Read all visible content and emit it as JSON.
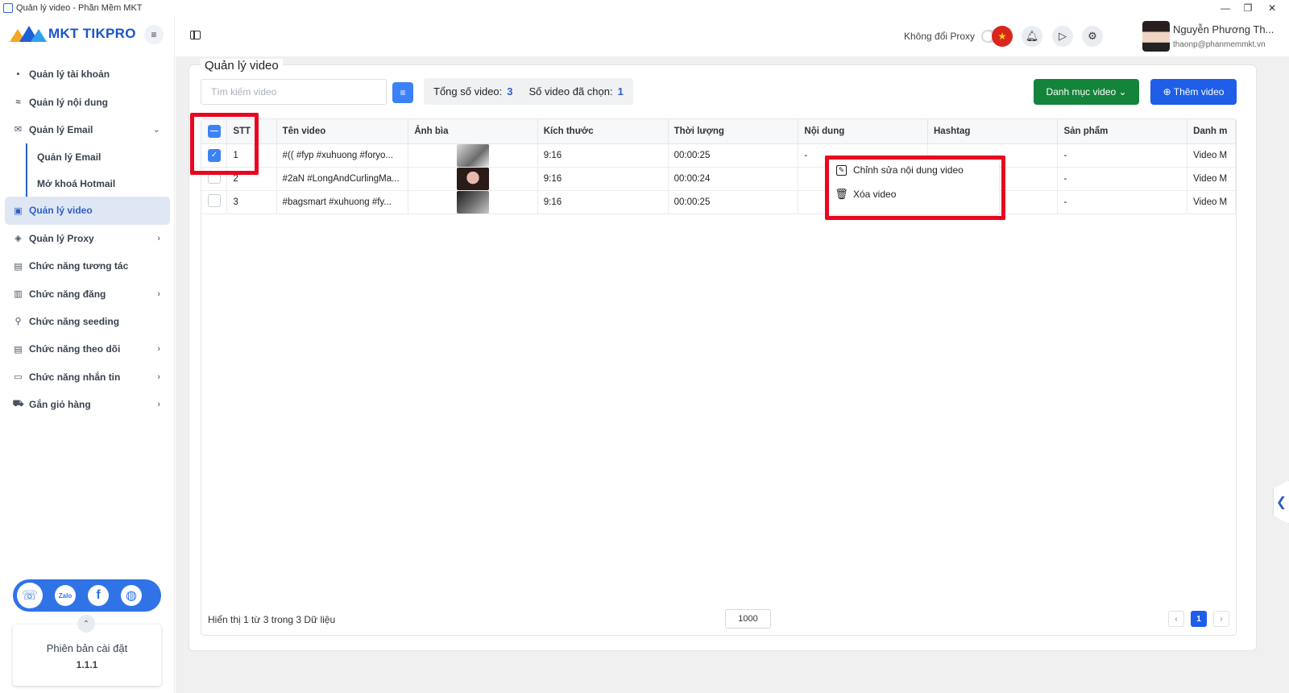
{
  "window": {
    "title": "Quản lý video - Phần Mềm MKT",
    "minimize": "—",
    "restore": "❐",
    "close": "✕"
  },
  "sidebar": {
    "logo_text": "MKT TIKPRO",
    "menu_icon": "≡",
    "items": [
      {
        "label": "Quản lý tài khoản",
        "icon": "grid-icon",
        "glyph": "▪",
        "chevron": ""
      },
      {
        "label": "Quản lý nội dung",
        "icon": "content-icon",
        "glyph": "≈",
        "chevron": ""
      },
      {
        "label": "Quản lý Email",
        "icon": "email-icon",
        "glyph": "✉",
        "chevron": "⌄"
      },
      {
        "label": "Quản lý video",
        "icon": "video-icon",
        "glyph": "▣",
        "chevron": ""
      },
      {
        "label": "Quản lý Proxy",
        "icon": "layers-icon",
        "glyph": "◈",
        "chevron": "›"
      },
      {
        "label": "Chức năng tương tác",
        "icon": "interact-icon",
        "glyph": "▤",
        "chevron": ""
      },
      {
        "label": "Chức năng đăng",
        "icon": "post-icon",
        "glyph": "▥",
        "chevron": "›"
      },
      {
        "label": "Chức năng seeding",
        "icon": "seeding-icon",
        "glyph": "⚲",
        "chevron": ""
      },
      {
        "label": "Chức năng theo dõi",
        "icon": "follow-icon",
        "glyph": "▤",
        "chevron": "›"
      },
      {
        "label": "Chức năng nhắn tin",
        "icon": "message-icon",
        "glyph": "▭",
        "chevron": "›"
      },
      {
        "label": "Gắn giỏ hàng",
        "icon": "cart-icon",
        "glyph": "⛟",
        "chevron": "›"
      }
    ],
    "sub_items": [
      {
        "label": "Quản lý Email"
      },
      {
        "label": "Mở khoá Hotmail"
      }
    ],
    "social": {
      "support_glyph": "☏",
      "zalo_glyph": "Zalo",
      "facebook_glyph": "f",
      "web_glyph": "◍"
    },
    "collapse_glyph": "⌃",
    "version_label": "Phiên bản cài đặt",
    "version_number": "1.1.1"
  },
  "topbar": {
    "proxy_label": "Không đổi Proxy",
    "flag_glyph": "★",
    "bell_glyph": "🔔︎",
    "play_glyph": "▷",
    "gear_glyph": "⚙",
    "user_name": "Nguyễn Phương Th...",
    "user_email": "thaonp@phanmemmkt.vn"
  },
  "page": {
    "title": "Quản lý video",
    "search_placeholder": "Tìm kiếm video",
    "filter_glyph": "≡",
    "total_label": "Tổng số video:",
    "total_value": "3",
    "selected_label": "Số video đã chọn:",
    "selected_value": "1",
    "category_button": "Danh mục video  ⌄",
    "add_button": "⊕  Thêm video"
  },
  "table": {
    "columns": [
      "STT",
      "Tên video",
      "Ảnh bìa",
      "Kích thước",
      "Thời lượng",
      "Nội dung",
      "Hashtag",
      "Sản phẩm",
      "Danh m"
    ],
    "rows": [
      {
        "stt": "1",
        "name": "#(( #fyp #xuhuong #foryo...",
        "size": "9:16",
        "duration": "00:00:25",
        "content": "-",
        "hashtag": "",
        "product": "-",
        "category": "Video M",
        "checked": true
      },
      {
        "stt": "2",
        "name": "#2aN #LongAndCurlingMa...",
        "size": "9:16",
        "duration": "00:00:24",
        "content": "",
        "hashtag": "",
        "product": "-",
        "category": "Video M",
        "checked": false
      },
      {
        "stt": "3",
        "name": "#bagsmart #xuhuong #fy...",
        "size": "9:16",
        "duration": "00:00:25",
        "content": "",
        "hashtag": "",
        "product": "-",
        "category": "Video M",
        "checked": false
      }
    ],
    "check_glyph": "✓",
    "partial_glyph": "—"
  },
  "pagination": {
    "summary": "Hiển thị 1 từ 3 trong 3 Dữ liệu",
    "page_size": "1000",
    "prev": "‹",
    "current": "1",
    "next": "›"
  },
  "context_menu": {
    "edit_label": "Chỉnh sửa nội dung video",
    "edit_glyph": "✎",
    "delete_label": "Xóa video",
    "delete_glyph": "🗑︎"
  },
  "side_tab_glyph": "❮",
  "colors": {
    "primary": "#1e5ee8",
    "success": "#14843a",
    "highlight": "#e8071f",
    "active_bg": "#dfe7f5"
  }
}
